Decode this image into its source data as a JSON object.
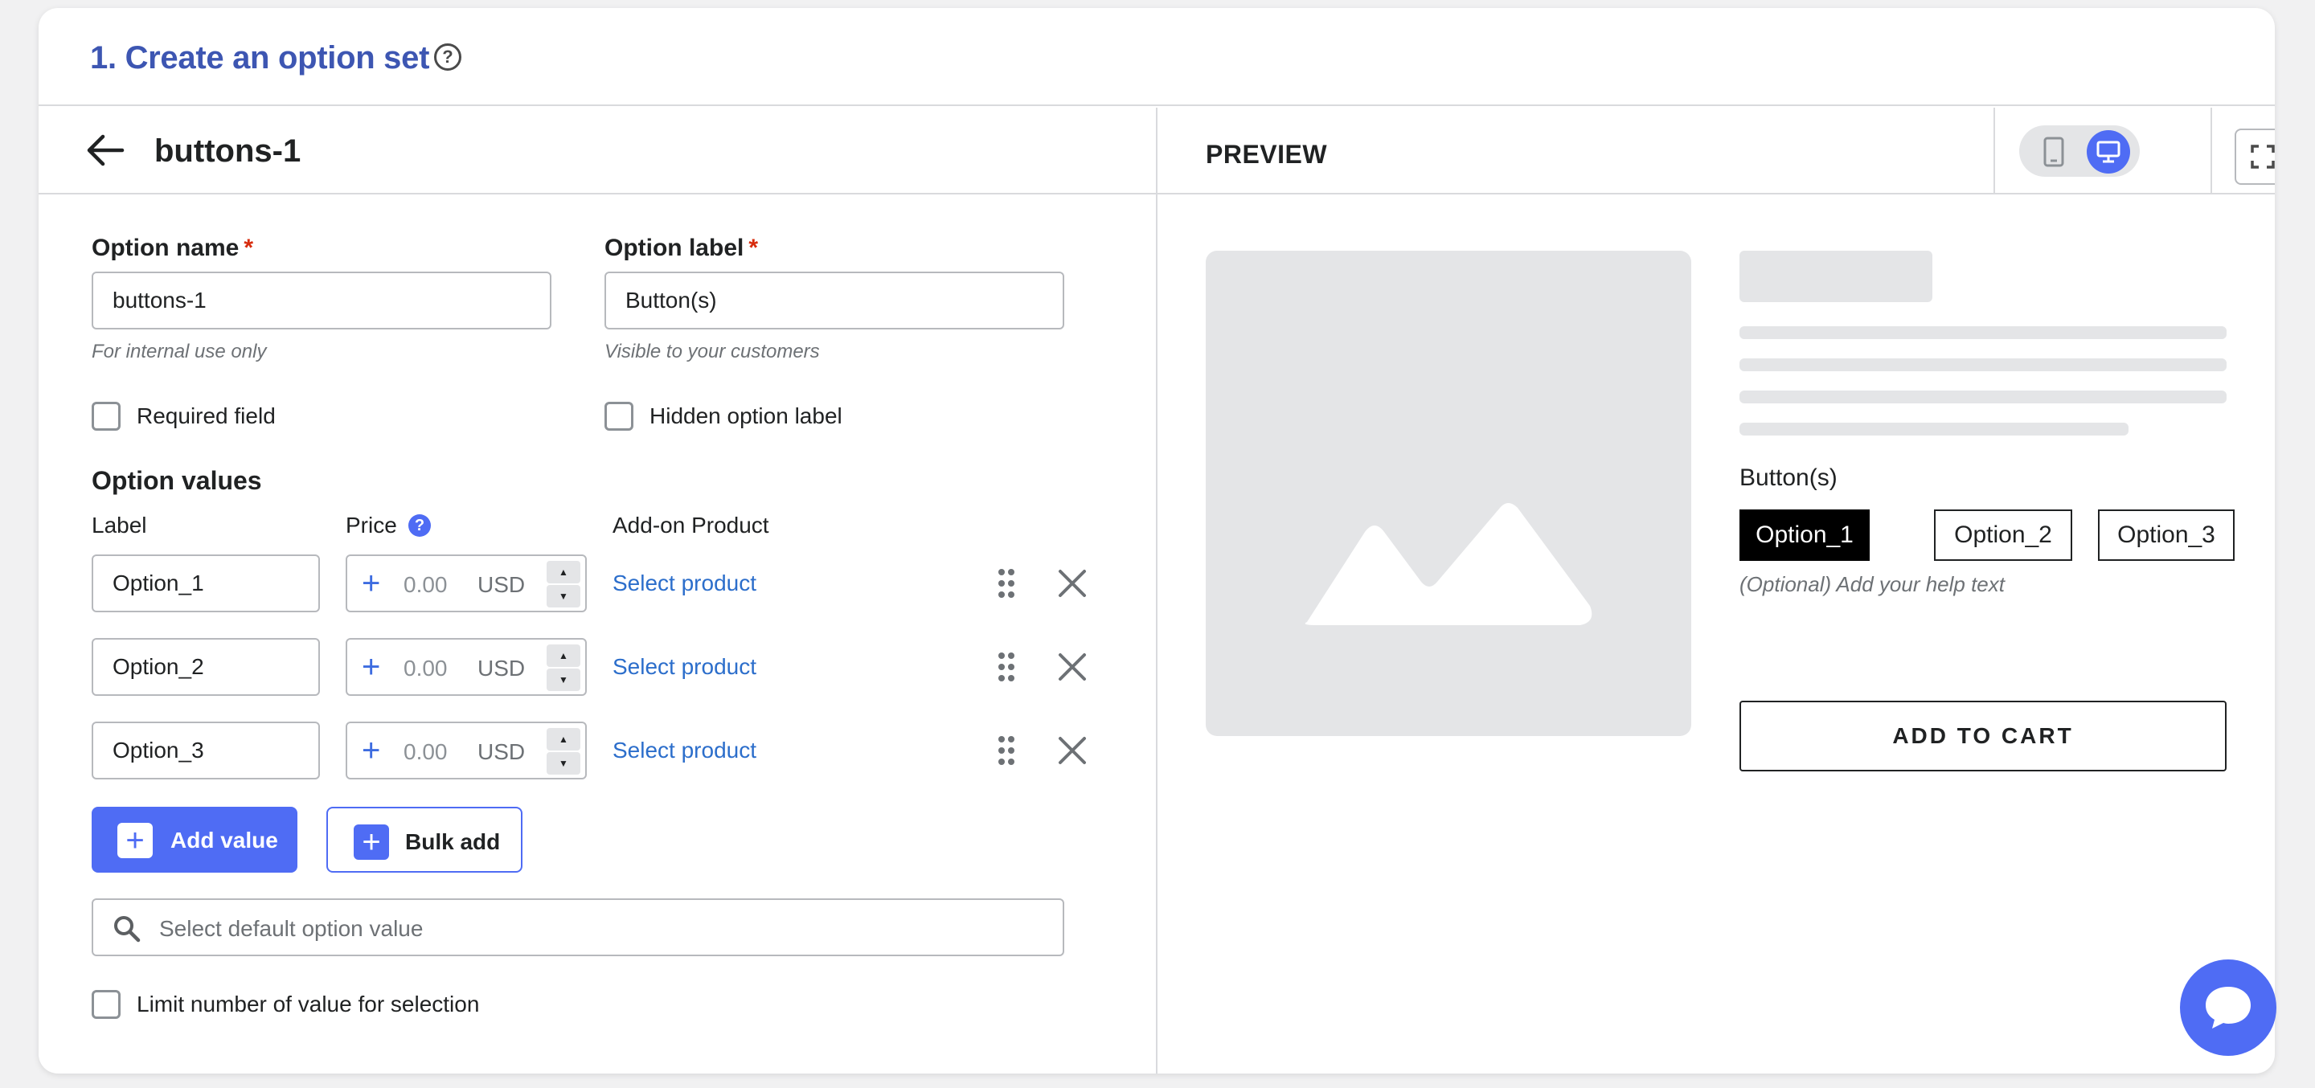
{
  "header": {
    "title": "1. Create an option set",
    "help_symbol": "?"
  },
  "editor": {
    "back_icon": "arrow-left-icon",
    "set_name": "buttons-1",
    "option_name": {
      "label": "Option name",
      "required_mark": "*",
      "value": "buttons-1",
      "hint": "For internal use only"
    },
    "option_label": {
      "label": "Option label",
      "required_mark": "*",
      "value": "Button(s)",
      "hint": "Visible to your customers"
    },
    "required_field": {
      "label": "Required field",
      "checked": false
    },
    "hidden_option_label": {
      "label": "Hidden option label",
      "checked": false
    },
    "values_section": {
      "title": "Option values",
      "columns": {
        "label": "Label",
        "price": "Price",
        "price_help": "?",
        "addon": "Add-on Product"
      },
      "rows": [
        {
          "label": "Option_1",
          "plus": "+",
          "price_placeholder": "0.00",
          "currency": "USD",
          "addon_link": "Select product"
        },
        {
          "label": "Option_2",
          "plus": "+",
          "price_placeholder": "0.00",
          "currency": "USD",
          "addon_link": "Select product"
        },
        {
          "label": "Option_3",
          "plus": "+",
          "price_placeholder": "0.00",
          "currency": "USD",
          "addon_link": "Select product"
        }
      ]
    },
    "add_value_button": "Add value",
    "bulk_add_button": "Bulk add",
    "plus_symbol": "+",
    "default_search": {
      "placeholder": "Select default option value"
    },
    "limit_selection": {
      "label": "Limit number of value for selection",
      "checked": false
    }
  },
  "preview": {
    "title": "PREVIEW",
    "device_mode": "desktop",
    "option_label": "Button(s)",
    "options": [
      {
        "label": "Option_1",
        "selected": true
      },
      {
        "label": "Option_2",
        "selected": false
      },
      {
        "label": "Option_3",
        "selected": false
      }
    ],
    "help_text": "(Optional) Add your help text",
    "add_to_cart": "ADD TO CART"
  },
  "colors": {
    "accent": "#4f6cf4",
    "title_blue": "#3d56b2",
    "link_blue": "#2c6ecb",
    "required_red": "#d72c0d"
  }
}
